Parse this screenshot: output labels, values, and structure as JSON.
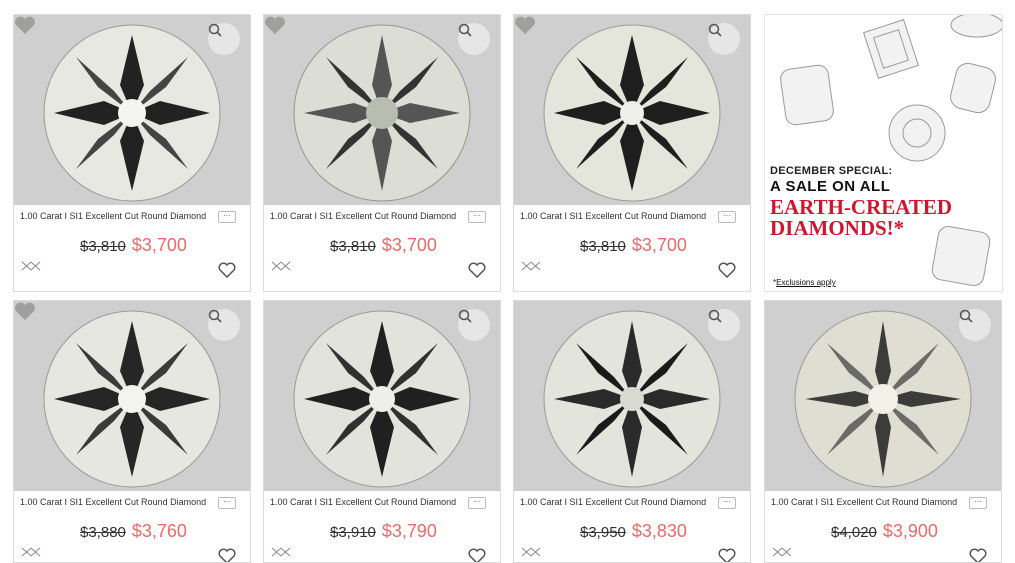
{
  "products": [
    {
      "title": "1.00 Carat I SI1 Excellent Cut Round Diamond",
      "old_price": "$3,810",
      "price": "$3,700"
    },
    {
      "title": "1.00 Carat I SI1 Excellent Cut Round Diamond",
      "old_price": "$3,810",
      "price": "$3,700"
    },
    {
      "title": "1.00 Carat I SI1 Excellent Cut Round Diamond",
      "old_price": "$3,810",
      "price": "$3,700"
    },
    {
      "title": "1.00 Carat I SI1 Excellent Cut Round Diamond",
      "old_price": "$3,880",
      "price": "$3,760"
    },
    {
      "title": "1.00 Carat I SI1 Excellent Cut Round Diamond",
      "old_price": "$3,910",
      "price": "$3,790"
    },
    {
      "title": "1.00 Carat I SI1 Excellent Cut Round Diamond",
      "old_price": "$3,950",
      "price": "$3,830"
    },
    {
      "title": "1.00 Carat I SI1 Excellent Cut Round Diamond",
      "old_price": "$4,020",
      "price": "$3,900"
    }
  ],
  "more_label": "···",
  "promo": {
    "line1": "DECEMBER SPECIAL:",
    "line2": "A SALE ON ALL",
    "line3a": "EARTH-CREATED",
    "line3b": "DIAMONDS!*",
    "note_prefix": "*",
    "note_link": "Exclusions apply"
  },
  "colors": {
    "sale_price": "#e96a6a",
    "promo_red": "#d0152f"
  }
}
